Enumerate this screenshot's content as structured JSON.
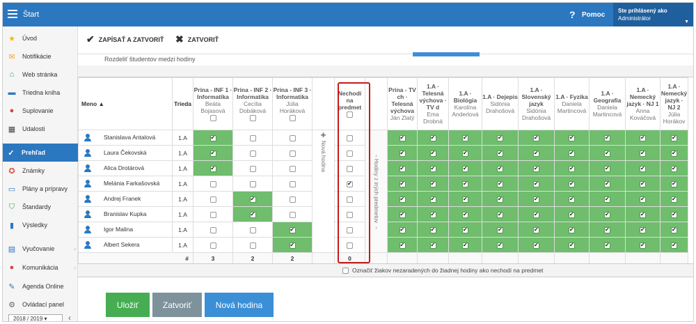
{
  "header": {
    "start_label": "Štart",
    "help_label": "Pomoc",
    "login_line1": "Ste prihlásený ako",
    "login_line2": "Administrátor"
  },
  "sidebar": {
    "items": [
      {
        "label": "Úvod",
        "icon": "star-icon"
      },
      {
        "label": "Notifikácie",
        "icon": "envelope-icon"
      },
      {
        "label": "Web stránka",
        "icon": "home-icon"
      },
      {
        "label": "Triedna kniha",
        "icon": "book-icon"
      },
      {
        "label": "Suplovanie",
        "icon": "person-icon"
      },
      {
        "label": "Udalosti",
        "icon": "calendar-icon"
      },
      {
        "label": "Prehľad",
        "icon": "check-circle-icon",
        "active": true
      },
      {
        "label": "Známky",
        "icon": "grade-icon"
      },
      {
        "label": "Plány a prípravy",
        "icon": "briefcase-icon"
      },
      {
        "label": "Štandardy",
        "icon": "shield-icon"
      },
      {
        "label": "Výsledky",
        "icon": "bar-chart-icon"
      },
      {
        "label": "Vyučovanie",
        "icon": "books-icon"
      },
      {
        "label": "Komunikácia",
        "icon": "chat-icon"
      },
      {
        "label": "Agenda Online",
        "icon": "pen-icon"
      },
      {
        "label": "Ovládací panel",
        "icon": "gear-icon"
      }
    ],
    "year": "2018 / 2019"
  },
  "toolbar": {
    "save_close": "ZAPÍSAŤ A ZATVORIŤ",
    "close": "ZATVORIŤ",
    "subtitle": "Rozdeliť študentov medzi hodiny"
  },
  "table": {
    "col_name": "Meno ▲",
    "col_class": "Trieda",
    "groups": [
      {
        "title": "Prina - INF 1 · Informatika",
        "teacher": "Beáta Bojasová"
      },
      {
        "title": "Prina - INF 2 · Informatika",
        "teacher": "Cecília Dobáková"
      },
      {
        "title": "Prina - INF 3 · Informatika",
        "teacher": "Júlia Horáková"
      }
    ],
    "new_hour_label": "Nová hodina",
    "not_attend": "Nechodí na predmet",
    "other_subjects_label": "Hodiny z iných predmetov",
    "others": [
      {
        "title": "Prina - TV ch · Telesná výchova",
        "teacher": "Ján Zlatý"
      },
      {
        "title": "1.A · Telesná výchova · TV d",
        "teacher": "Ema Drobná"
      },
      {
        "title": "1.A · Biológia",
        "teacher": "Karolína Anderlová"
      },
      {
        "title": "1.A · Dejepis",
        "teacher": "Sidónia Drahošová"
      },
      {
        "title": "1.A · Slovenský jazyk",
        "teacher": "Sidónia Drahošová"
      },
      {
        "title": "1.A · Fyzika",
        "teacher": "Daniela Martincová"
      },
      {
        "title": "1.A · Geografia",
        "teacher": "Daniela Martincová"
      },
      {
        "title": "1.A · Nemecký jazyk · NJ 1",
        "teacher": "Anna Kováčová"
      },
      {
        "title": "1.A · Nemecký jazyk · NJ 2",
        "teacher": "Júlia Horákov"
      }
    ],
    "rows": [
      {
        "name": "Stanislava Antalová",
        "class": "1.A",
        "group": 0,
        "not_attend": false
      },
      {
        "name": "Laura Čekovská",
        "class": "1.A",
        "group": 0,
        "not_attend": false
      },
      {
        "name": "Alica Drotárová",
        "class": "1.A",
        "group": 0,
        "not_attend": false
      },
      {
        "name": "Melánia Farkašovská",
        "class": "1.A",
        "group": -1,
        "not_attend": true
      },
      {
        "name": "Andrej Franek",
        "class": "1.A",
        "group": 1,
        "not_attend": false
      },
      {
        "name": "Branislav Kupka",
        "class": "1.A",
        "group": 1,
        "not_attend": false
      },
      {
        "name": "Igor Malina",
        "class": "1.A",
        "group": 2,
        "not_attend": false
      },
      {
        "name": "Albert Sekera",
        "class": "1.A",
        "group": 2,
        "not_attend": false
      }
    ],
    "totals_label": "#",
    "totals": [
      "3",
      "2",
      "2"
    ],
    "not_attend_total": "0",
    "footer_checkbox_label": "Označiť žiakov nezaradených do žiadnej hodiny ako nechodí na predmet"
  },
  "buttons": {
    "save": "Uložiť",
    "close": "Zatvoriť",
    "new_hour": "Nová hodina"
  },
  "colors": {
    "topbar": "#2b77c0",
    "green": "#6fbd6d",
    "save_btn": "#46ad52",
    "close_btn": "#7e929c",
    "new_btn": "#3a8fd7",
    "highlight": "#c21b1b"
  }
}
